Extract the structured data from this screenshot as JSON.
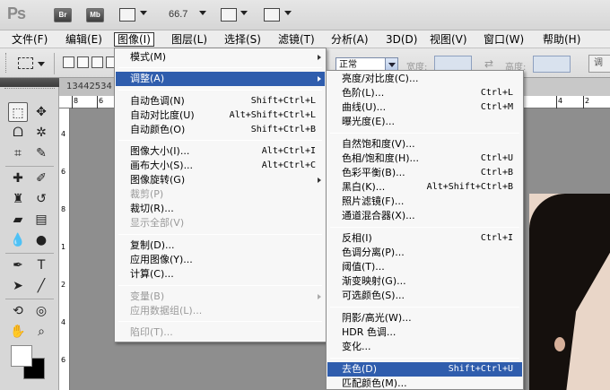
{
  "app": {
    "logo": "Ps",
    "bridge_label": "Br",
    "minibridge_label": "Mb",
    "zoom_value": "66.7"
  },
  "menubar": {
    "items": [
      {
        "label": "文件(F)"
      },
      {
        "label": "编辑(E)"
      },
      {
        "label": "图像(I)"
      },
      {
        "label": "图层(L)"
      },
      {
        "label": "选择(S)"
      },
      {
        "label": "滤镜(T)"
      },
      {
        "label": "分析(A)"
      },
      {
        "label": "3D(D)"
      },
      {
        "label": "视图(V)"
      },
      {
        "label": "窗口(W)"
      },
      {
        "label": "帮助(H)"
      }
    ]
  },
  "options": {
    "mode_value": "正常",
    "width_label": "宽度:",
    "height_label": "高度:",
    "adjust_label": "调"
  },
  "document": {
    "tab_title": "13442534",
    "ruler_numbers": [
      "8",
      "6",
      "4",
      "2"
    ],
    "vruler_numbers": [
      "4",
      "6",
      "8",
      "1",
      "2",
      "4",
      "6"
    ]
  },
  "image_menu": {
    "items": [
      {
        "label": "模式(M)",
        "shortcut": "",
        "submenu": true,
        "disabled": false,
        "highlight": false
      },
      {
        "label": "调整(A)",
        "shortcut": "",
        "submenu": true,
        "disabled": false,
        "highlight": true
      },
      {
        "label": "自动色调(N)",
        "shortcut": "Shift+Ctrl+L",
        "submenu": false,
        "disabled": false,
        "highlight": false
      },
      {
        "label": "自动对比度(U)",
        "shortcut": "Alt+Shift+Ctrl+L",
        "submenu": false,
        "disabled": false,
        "highlight": false
      },
      {
        "label": "自动颜色(O)",
        "shortcut": "Shift+Ctrl+B",
        "submenu": false,
        "disabled": false,
        "highlight": false
      },
      {
        "label": "图像大小(I)...",
        "shortcut": "Alt+Ctrl+I",
        "submenu": false,
        "disabled": false,
        "highlight": false
      },
      {
        "label": "画布大小(S)...",
        "shortcut": "Alt+Ctrl+C",
        "submenu": false,
        "disabled": false,
        "highlight": false
      },
      {
        "label": "图像旋转(G)",
        "shortcut": "",
        "submenu": true,
        "disabled": false,
        "highlight": false
      },
      {
        "label": "裁剪(P)",
        "shortcut": "",
        "submenu": false,
        "disabled": true,
        "highlight": false
      },
      {
        "label": "裁切(R)...",
        "shortcut": "",
        "submenu": false,
        "disabled": false,
        "highlight": false
      },
      {
        "label": "显示全部(V)",
        "shortcut": "",
        "submenu": false,
        "disabled": true,
        "highlight": false
      },
      {
        "label": "复制(D)...",
        "shortcut": "",
        "submenu": false,
        "disabled": false,
        "highlight": false
      },
      {
        "label": "应用图像(Y)...",
        "shortcut": "",
        "submenu": false,
        "disabled": false,
        "highlight": false
      },
      {
        "label": "计算(C)...",
        "shortcut": "",
        "submenu": false,
        "disabled": false,
        "highlight": false
      },
      {
        "label": "变量(B)",
        "shortcut": "",
        "submenu": true,
        "disabled": true,
        "highlight": false
      },
      {
        "label": "应用数据组(L)...",
        "shortcut": "",
        "submenu": false,
        "disabled": true,
        "highlight": false
      },
      {
        "label": "陷印(T)...",
        "shortcut": "",
        "submenu": false,
        "disabled": true,
        "highlight": false
      }
    ]
  },
  "adjust_menu": {
    "items": [
      {
        "label": "亮度/对比度(C)...",
        "shortcut": "",
        "highlight": false
      },
      {
        "label": "色阶(L)...",
        "shortcut": "Ctrl+L",
        "highlight": false
      },
      {
        "label": "曲线(U)...",
        "shortcut": "Ctrl+M",
        "highlight": false
      },
      {
        "label": "曝光度(E)...",
        "shortcut": "",
        "highlight": false
      },
      {
        "label": "自然饱和度(V)...",
        "shortcut": "",
        "highlight": false
      },
      {
        "label": "色相/饱和度(H)...",
        "shortcut": "Ctrl+U",
        "highlight": false
      },
      {
        "label": "色彩平衡(B)...",
        "shortcut": "Ctrl+B",
        "highlight": false
      },
      {
        "label": "黑白(K)...",
        "shortcut": "Alt+Shift+Ctrl+B",
        "highlight": false
      },
      {
        "label": "照片滤镜(F)...",
        "shortcut": "",
        "highlight": false
      },
      {
        "label": "通道混合器(X)...",
        "shortcut": "",
        "highlight": false
      },
      {
        "label": "反相(I)",
        "shortcut": "Ctrl+I",
        "highlight": false
      },
      {
        "label": "色调分离(P)...",
        "shortcut": "",
        "highlight": false
      },
      {
        "label": "阈值(T)...",
        "shortcut": "",
        "highlight": false
      },
      {
        "label": "渐变映射(G)...",
        "shortcut": "",
        "highlight": false
      },
      {
        "label": "可选颜色(S)...",
        "shortcut": "",
        "highlight": false
      },
      {
        "label": "阴影/高光(W)...",
        "shortcut": "",
        "highlight": false
      },
      {
        "label": "HDR 色调...",
        "shortcut": "",
        "highlight": false
      },
      {
        "label": "变化...",
        "shortcut": "",
        "highlight": false
      },
      {
        "label": "去色(D)",
        "shortcut": "Shift+Ctrl+U",
        "highlight": true
      },
      {
        "label": "匹配颜色(M)...",
        "shortcut": "",
        "highlight": false
      }
    ]
  },
  "colors": {
    "highlight": "#2f5dad",
    "foreground": "#ffffff",
    "background": "#000000"
  }
}
